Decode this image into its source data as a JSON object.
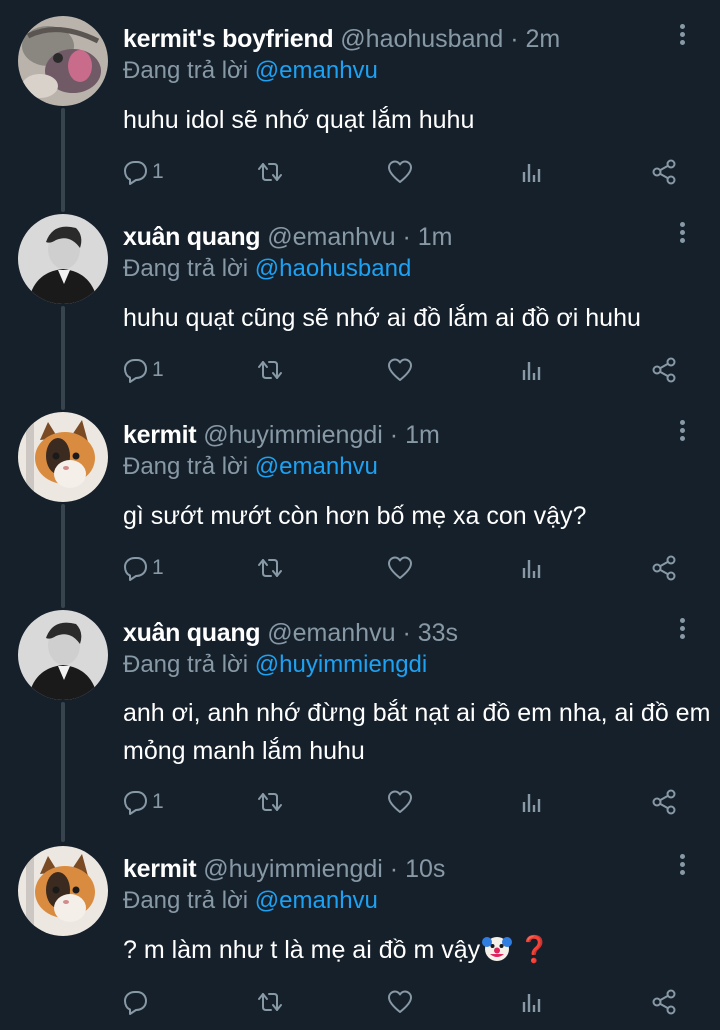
{
  "tweets": [
    {
      "name": "kermit's boyfriend",
      "handle": "@haohusband",
      "time": "2m",
      "reply_prefix": "Đang trả lời",
      "reply_to": "@emanhvu",
      "text": "huhu idol sẽ nhớ quạt lắm huhu",
      "reply_count": "1",
      "avatar": "frog-photo-avatar"
    },
    {
      "name": "xuân quang",
      "handle": "@emanhvu",
      "time": "1m",
      "reply_prefix": "Đang trả lời",
      "reply_to": "@haohusband",
      "text": "huhu quạt cũng sẽ nhớ ai đồ lắm ai đồ ơi huhu",
      "reply_count": "1",
      "avatar": "person-photo-avatar"
    },
    {
      "name": "kermit",
      "handle": "@huyimmiengdi",
      "time": "1m",
      "reply_prefix": "Đang trả lời",
      "reply_to": "@emanhvu",
      "text": "gì sướt mướt còn hơn bố mẹ xa con vậy?",
      "reply_count": "1",
      "avatar": "cat-photo-avatar"
    },
    {
      "name": "xuân quang",
      "handle": "@emanhvu",
      "time": "33s",
      "reply_prefix": "Đang trả lời",
      "reply_to": "@huyimmiengdi",
      "text": "anh ơi, anh nhớ đừng bắt nạt ai đồ em nha, ai đồ em mỏng manh lắm huhu",
      "reply_count": "1",
      "avatar": "person-photo-avatar"
    },
    {
      "name": "kermit",
      "handle": "@huyimmiengdi",
      "time": "10s",
      "reply_prefix": "Đang trả lời",
      "reply_to": "@emanhvu",
      "text": "? m làm như t là mẹ ai đồ m vậy",
      "text_emoji": [
        "clown-face-emoji",
        "red-question-mark-emoji"
      ],
      "reply_count": "",
      "avatar": "cat-photo-avatar"
    }
  ],
  "separator": "·",
  "colors": {
    "background": "#15202b",
    "primary_text": "#ffffff",
    "secondary_text": "#8899a6",
    "link": "#1da1f2",
    "thread_line": "#38444d"
  },
  "action_icons": [
    "reply-icon",
    "retweet-icon",
    "like-icon",
    "analytics-icon",
    "share-icon"
  ]
}
